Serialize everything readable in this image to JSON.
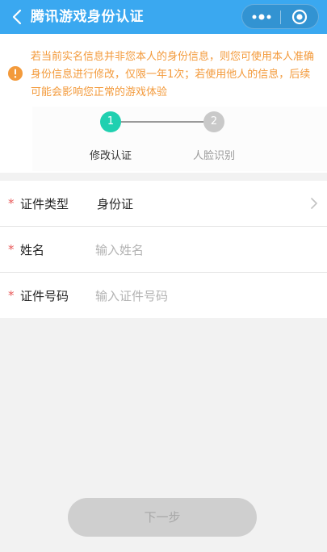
{
  "header": {
    "title": "腾讯游戏身份认证",
    "back_icon": "chevron-left-icon",
    "more_icon": "more-dots-icon",
    "close_icon": "mini-program-close-icon",
    "background": "#3aa8f0"
  },
  "notice": {
    "icon": "info-icon",
    "icon_color": "#f39a3b",
    "text": "若当前实名信息并非您本人的身份信息，则您可使用本人准确身份信息进行修改，仅限一年1次；若使用他人的信息，后续可能会影响您正常的游戏体验"
  },
  "steps": [
    {
      "number": "1",
      "label": "修改认证",
      "active": true,
      "color": "#20d0b0"
    },
    {
      "number": "2",
      "label": "人脸识别",
      "active": false,
      "color": "#c9c9c9"
    }
  ],
  "form": {
    "id_type": {
      "label": "证件类型",
      "value": "身份证"
    },
    "name": {
      "label": "姓名",
      "placeholder": "输入姓名",
      "value": ""
    },
    "id_number": {
      "label": "证件号码",
      "placeholder": "输入证件号码",
      "value": ""
    },
    "required_mark": "*"
  },
  "next_button": {
    "label": "下一步",
    "enabled": false
  }
}
